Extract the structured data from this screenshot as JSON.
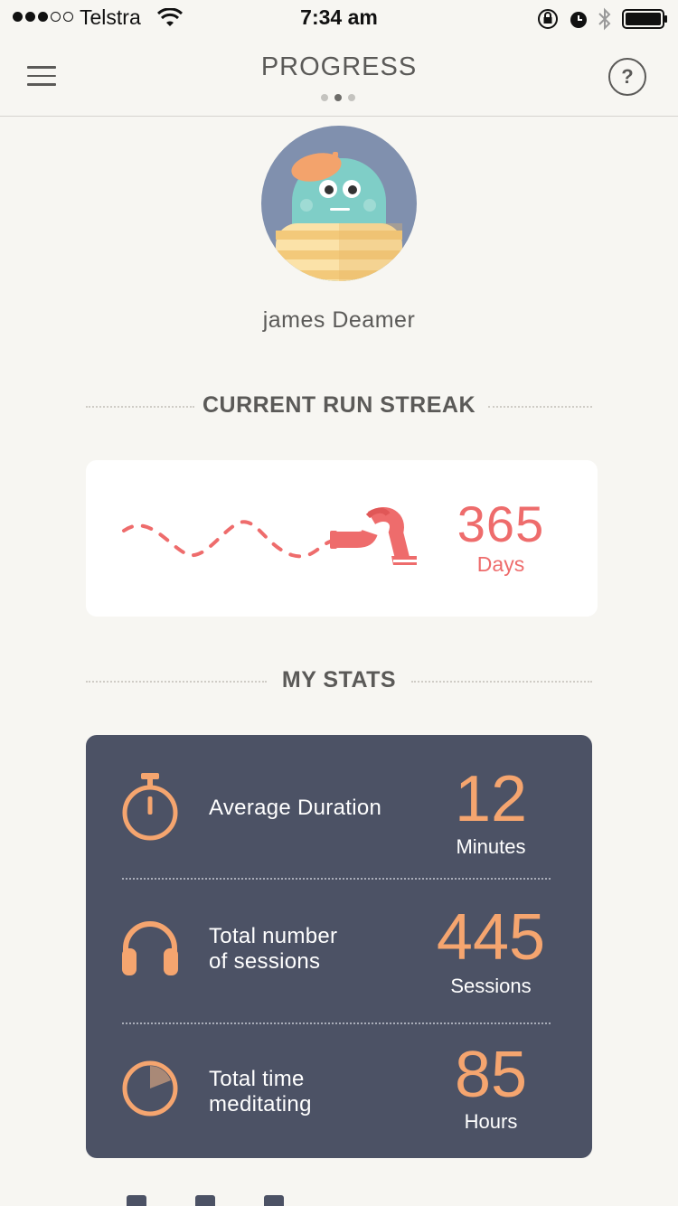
{
  "status_bar": {
    "carrier": "Telstra",
    "time": "7:34 am"
  },
  "nav": {
    "title": "PROGRESS",
    "help_label": "?"
  },
  "profile": {
    "name": "james Deamer"
  },
  "streak": {
    "section_title": "CURRENT RUN STREAK",
    "value": "365",
    "unit": "Days"
  },
  "stats": {
    "section_title": "MY STATS",
    "items": [
      {
        "label_line1": "Average Duration",
        "label_line2": "",
        "value": "12",
        "unit": "Minutes",
        "icon": "stopwatch-icon"
      },
      {
        "label_line1": "Total number",
        "label_line2": "of sessions",
        "value": "445",
        "unit": "Sessions",
        "icon": "headphones-icon"
      },
      {
        "label_line1": "Total time",
        "label_line2": "meditating",
        "value": "85",
        "unit": "Hours",
        "icon": "pie-clock-icon"
      }
    ]
  },
  "colors": {
    "accent_orange": "#f5a56f",
    "streak_red": "#ee6c6c",
    "card_dark": "#4c5265",
    "background": "#f7f6f2"
  }
}
